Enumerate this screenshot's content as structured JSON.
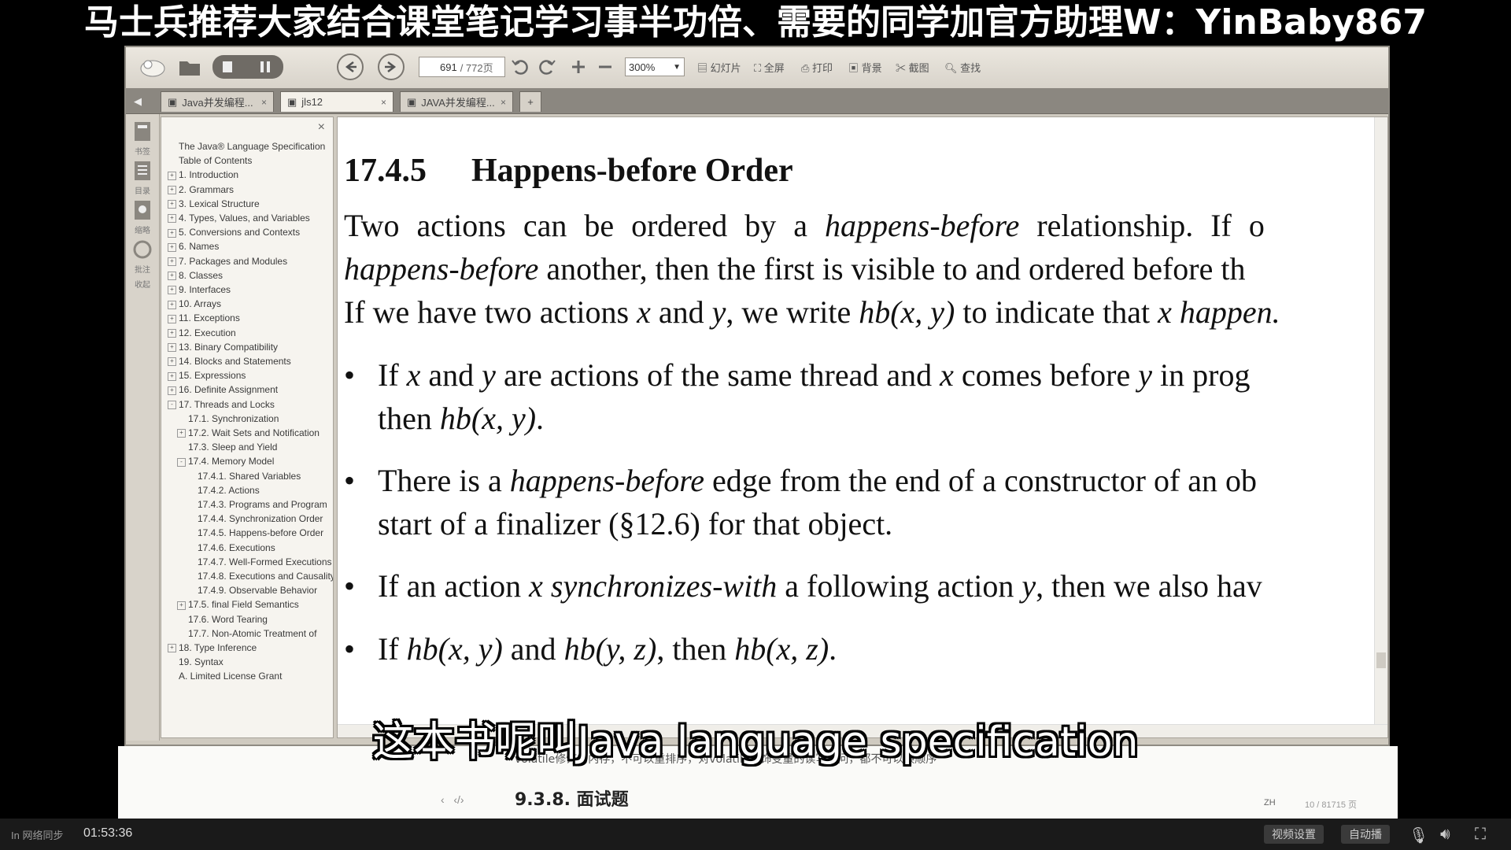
{
  "banner": {
    "text": "马士兵推荐大家结合课堂笔记学习事半功倍、需要的同学加官方助理W：YinBaby867"
  },
  "toolbar": {
    "page_current": "691",
    "page_total": "/ 772页",
    "zoom": "300%",
    "buttons": [
      "幻灯片",
      "全屏",
      "打印",
      "背景",
      "截图",
      "查找"
    ]
  },
  "tabs": [
    {
      "label": "Java并发编程...",
      "active": false
    },
    {
      "label": "jls12",
      "active": true
    },
    {
      "label": "JAVA并发编程...",
      "active": false
    }
  ],
  "rail": {
    "items": [
      "书签",
      "目录",
      "缩略",
      "批注",
      "收起"
    ]
  },
  "toc": {
    "items": [
      {
        "label": "The Java® Language Specification",
        "level": 0,
        "toggle": ""
      },
      {
        "label": "Table of Contents",
        "level": 0,
        "toggle": ""
      },
      {
        "label": "1. Introduction",
        "level": 0,
        "toggle": "+"
      },
      {
        "label": "2. Grammars",
        "level": 0,
        "toggle": "+"
      },
      {
        "label": "3. Lexical Structure",
        "level": 0,
        "toggle": "+"
      },
      {
        "label": "4. Types, Values, and Variables",
        "level": 0,
        "toggle": "+"
      },
      {
        "label": "5. Conversions and Contexts",
        "level": 0,
        "toggle": "+"
      },
      {
        "label": "6. Names",
        "level": 0,
        "toggle": "+"
      },
      {
        "label": "7. Packages and Modules",
        "level": 0,
        "toggle": "+"
      },
      {
        "label": "8. Classes",
        "level": 0,
        "toggle": "+"
      },
      {
        "label": "9. Interfaces",
        "level": 0,
        "toggle": "+"
      },
      {
        "label": "10. Arrays",
        "level": 0,
        "toggle": "+"
      },
      {
        "label": "11. Exceptions",
        "level": 0,
        "toggle": "+"
      },
      {
        "label": "12. Execution",
        "level": 0,
        "toggle": "+"
      },
      {
        "label": "13. Binary Compatibility",
        "level": 0,
        "toggle": "+"
      },
      {
        "label": "14. Blocks and Statements",
        "level": 0,
        "toggle": "+"
      },
      {
        "label": "15. Expressions",
        "level": 0,
        "toggle": "+"
      },
      {
        "label": "16. Definite Assignment",
        "level": 0,
        "toggle": "+"
      },
      {
        "label": "17. Threads and Locks",
        "level": 0,
        "toggle": "-"
      },
      {
        "label": "17.1. Synchronization",
        "level": 1,
        "toggle": ""
      },
      {
        "label": "17.2. Wait Sets and Notification",
        "level": 1,
        "toggle": "+"
      },
      {
        "label": "17.3. Sleep and Yield",
        "level": 1,
        "toggle": ""
      },
      {
        "label": "17.4. Memory Model",
        "level": 1,
        "toggle": "-"
      },
      {
        "label": "17.4.1. Shared Variables",
        "level": 2,
        "toggle": ""
      },
      {
        "label": "17.4.2. Actions",
        "level": 2,
        "toggle": ""
      },
      {
        "label": "17.4.3. Programs and Program",
        "level": 2,
        "toggle": ""
      },
      {
        "label": "17.4.4. Synchronization Order",
        "level": 2,
        "toggle": ""
      },
      {
        "label": "17.4.5. Happens-before Order",
        "level": 2,
        "toggle": ""
      },
      {
        "label": "17.4.6. Executions",
        "level": 2,
        "toggle": ""
      },
      {
        "label": "17.4.7. Well-Formed Executions",
        "level": 2,
        "toggle": ""
      },
      {
        "label": "17.4.8. Executions and Causality",
        "level": 2,
        "toggle": ""
      },
      {
        "label": "17.4.9. Observable Behavior",
        "level": 2,
        "toggle": ""
      },
      {
        "label": "17.5. final Field Semantics",
        "level": 1,
        "toggle": "+"
      },
      {
        "label": "17.6. Word Tearing",
        "level": 1,
        "toggle": ""
      },
      {
        "label": "17.7. Non-Atomic Treatment of",
        "level": 1,
        "toggle": ""
      },
      {
        "label": "18. Type Inference",
        "level": 0,
        "toggle": "+"
      },
      {
        "label": "19. Syntax",
        "level": 0,
        "toggle": ""
      },
      {
        "label": "A. Limited License Grant",
        "level": 0,
        "toggle": ""
      }
    ]
  },
  "doc": {
    "heading_num": "17.4.5",
    "heading_title": "Happens-before Order",
    "p1": {
      "l1a": "Two actions can be ordered by a ",
      "l1b": "happens-before",
      "l1c": " relationship. If o",
      "l2a": "happens-before",
      "l2b": " another, then the first is visible to and ordered before th"
    },
    "p2": {
      "a": "If we have two actions ",
      "b": "x",
      "c": " and ",
      "d": "y",
      "e": ", we write ",
      "f": "hb(x, y)",
      "g": " to indicate that ",
      "h": "x",
      "i": " happen."
    },
    "b1": {
      "a": "If ",
      "b": "x",
      "c": " and ",
      "d": "y",
      "e": " are actions of the same thread and ",
      "f": "x",
      "g": " comes before ",
      "h": "y",
      "i": " in prog",
      "l2a": "then ",
      "l2b": "hb(x, y)",
      "l2c": "."
    },
    "b2": {
      "a": "There is a ",
      "b": "happens-before",
      "c": " edge from the end of a constructor of an ob",
      "l2": "start of a finalizer (§12.6) for that object."
    },
    "b3": {
      "a": "If an action ",
      "b": "x",
      "c": " ",
      "d": "synchronizes-with",
      "e": " a following action ",
      "f": "y",
      "g": ", then we also hav"
    },
    "b4": {
      "a": "If ",
      "b": "hb(x, y)",
      "c": " and ",
      "d": "hb(y, z)",
      "e": ", then ",
      "f": "hb(x, z)",
      "g": "."
    }
  },
  "lower": {
    "note": "volatile修饰的内存，不可以重排序，对volatile修饰变量的读写访问，都不可以换顺序",
    "heading": "9.3.8. 面试题",
    "lang": "ZH",
    "page": "10 / 81715 页"
  },
  "subtitle": "这本书呢叫Java language specification",
  "player": {
    "left_label": "In 网络同步",
    "time": "01:53:36",
    "btn1": "视频设置",
    "btn2": "自动播"
  }
}
